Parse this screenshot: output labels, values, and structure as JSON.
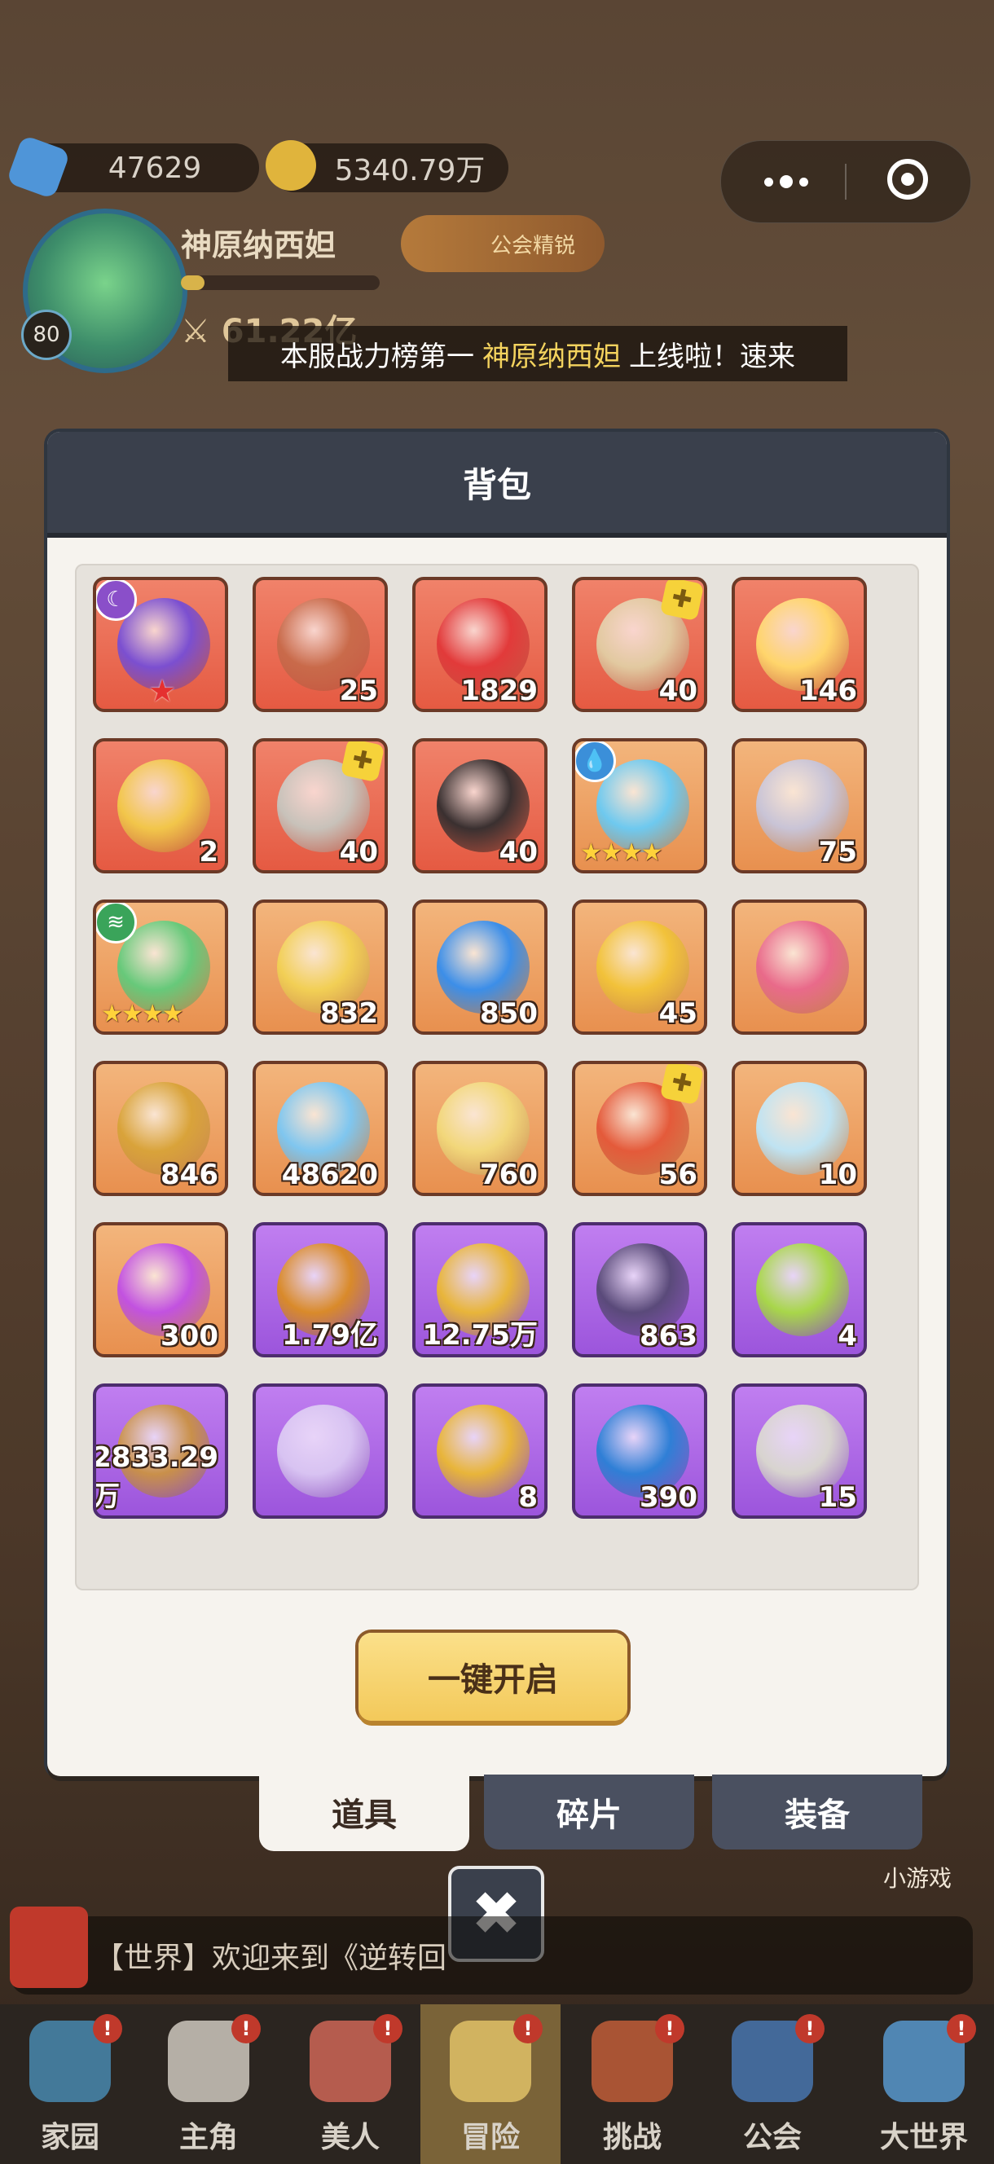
{
  "hud": {
    "diamonds": "47629",
    "gold": "5340.79万",
    "player_name": "神原纳西妲",
    "level": "80",
    "power": "61.22亿",
    "guild_badge": "公会精锐",
    "xp_progress": 0.12
  },
  "announcement": {
    "prefix": "本服战力榜第一",
    "name": "神原纳西妲",
    "suffix": "上线啦！速来"
  },
  "modal": {
    "title": "背包",
    "open_all_label": "一键开启"
  },
  "tabs": [
    {
      "label": "道具",
      "active": true
    },
    {
      "label": "碎片",
      "active": false
    },
    {
      "label": "装备",
      "active": false
    }
  ],
  "close_label": "✖",
  "items": [
    {
      "icon": "purple-hood-icon",
      "count": "",
      "bg": "red",
      "tag": "moon",
      "rank_star": true
    },
    {
      "icon": "chest-icon",
      "count": "25",
      "bg": "red"
    },
    {
      "icon": "red-crystal-icon",
      "count": "1829",
      "bg": "red"
    },
    {
      "icon": "staff-icon",
      "count": "40",
      "bg": "red",
      "puzzle": true
    },
    {
      "icon": "clover-ticket-icon",
      "count": "146",
      "bg": "red"
    },
    {
      "icon": "golden-crest-icon",
      "count": "2",
      "bg": "red"
    },
    {
      "icon": "tank-icon",
      "count": "40",
      "bg": "red",
      "puzzle": true
    },
    {
      "icon": "cat-character-icon",
      "count": "40",
      "bg": "red"
    },
    {
      "icon": "blue-hood-icon",
      "count": "",
      "bg": "orange",
      "tag": "water",
      "stars": 4
    },
    {
      "icon": "silver-chest-icon",
      "count": "75",
      "bg": "orange"
    },
    {
      "icon": "green-hood-icon",
      "count": "",
      "bg": "orange",
      "tag": "wind",
      "stars": 4
    },
    {
      "icon": "star-medal-icon",
      "count": "832",
      "bg": "orange"
    },
    {
      "icon": "blue-star-icon",
      "count": "850",
      "bg": "orange"
    },
    {
      "icon": "gold-ore-icon",
      "count": "45",
      "bg": "orange"
    },
    {
      "icon": "element-flame-icon",
      "count": "",
      "bg": "orange"
    },
    {
      "icon": "amber-ore-icon",
      "count": "846",
      "bg": "orange"
    },
    {
      "icon": "ice-crystal-icon",
      "count": "48620",
      "bg": "orange"
    },
    {
      "icon": "gold-ticket-icon",
      "count": "760",
      "bg": "orange"
    },
    {
      "icon": "dragon-icon",
      "count": "56",
      "bg": "orange",
      "puzzle": true
    },
    {
      "icon": "spirit-orb-icon",
      "count": "10",
      "bg": "orange"
    },
    {
      "icon": "purple-flame-icon",
      "count": "300",
      "bg": "orange"
    },
    {
      "icon": "amber-gem-icon",
      "count": "1.79亿",
      "bg": "purple"
    },
    {
      "icon": "m-coin-icon",
      "count": "12.75万",
      "bg": "purple"
    },
    {
      "icon": "purple-chest-icon",
      "count": "863",
      "bg": "purple"
    },
    {
      "icon": "green-ticket-icon",
      "count": "4",
      "bg": "purple"
    },
    {
      "icon": "wood-logs-icon",
      "count": "2833.29万",
      "bg": "purple"
    },
    {
      "icon": "m-ticket-icon",
      "count": "",
      "bg": "purple"
    },
    {
      "icon": "red-ticket-icon",
      "count": "8",
      "bg": "purple"
    },
    {
      "icon": "cloud-coin-icon",
      "count": "390",
      "bg": "purple"
    },
    {
      "icon": "stone-icon",
      "count": "15",
      "bg": "purple"
    }
  ],
  "chat": {
    "text": "【世界】欢迎来到《逆转回"
  },
  "mini_game_label": "小游戏",
  "nav": [
    {
      "label": "家园",
      "icon": "home-icon",
      "badge": "!"
    },
    {
      "label": "主角",
      "icon": "hero-icon",
      "badge": "!"
    },
    {
      "label": "美人",
      "icon": "beauty-icon",
      "badge": "!"
    },
    {
      "label": "冒险",
      "icon": "adventure-icon",
      "badge": "!",
      "active": true
    },
    {
      "label": "挑战",
      "icon": "challenge-icon",
      "badge": "!"
    },
    {
      "label": "公会",
      "icon": "guild-icon",
      "badge": "!"
    },
    {
      "label": "大世界",
      "icon": "world-icon",
      "badge": "!"
    }
  ],
  "colors": {
    "slot_red": "#e55a42",
    "slot_orange": "#e8904f",
    "slot_purple": "#9c55dc",
    "header": "#3a404c",
    "button_gold": "#f3c95a"
  }
}
